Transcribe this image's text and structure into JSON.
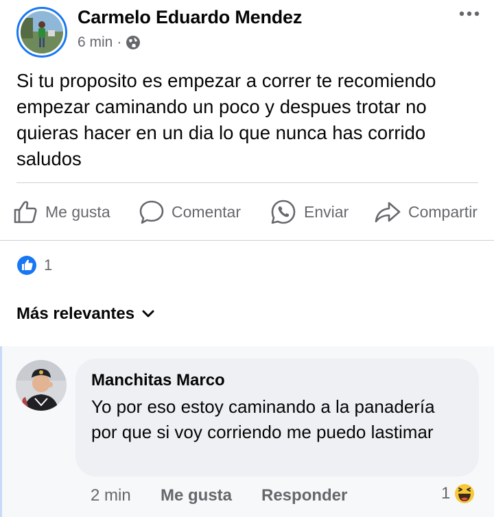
{
  "post": {
    "author": "Carmelo Eduardo Mendez",
    "time": "6 min",
    "separator": "·",
    "privacy_icon": "globe-icon",
    "text": "Si tu proposito es empezar a correr te recomiendo empezar caminando un poco y despues trotar no quieras hacer en un dia lo que nunca has corrido saludos"
  },
  "actions": {
    "like": "Me gusta",
    "comment": "Comentar",
    "send": "Enviar",
    "share": "Compartir"
  },
  "reactions": {
    "count": "1",
    "icon": "like-reaction-icon"
  },
  "sort": {
    "label": "Más relevantes"
  },
  "comment": {
    "author": "Manchitas Marco",
    "text": "Yo por eso estoy caminando a la panadería por que si voy corriendo me puedo lastimar",
    "time": "2 min",
    "like": "Me gusta",
    "reply": "Responder",
    "reaction_count": "1",
    "reaction_icon": "haha-reaction-icon"
  },
  "colors": {
    "accent": "#1877f2",
    "secondary_text": "#65676b",
    "divider": "#ced0d4"
  }
}
